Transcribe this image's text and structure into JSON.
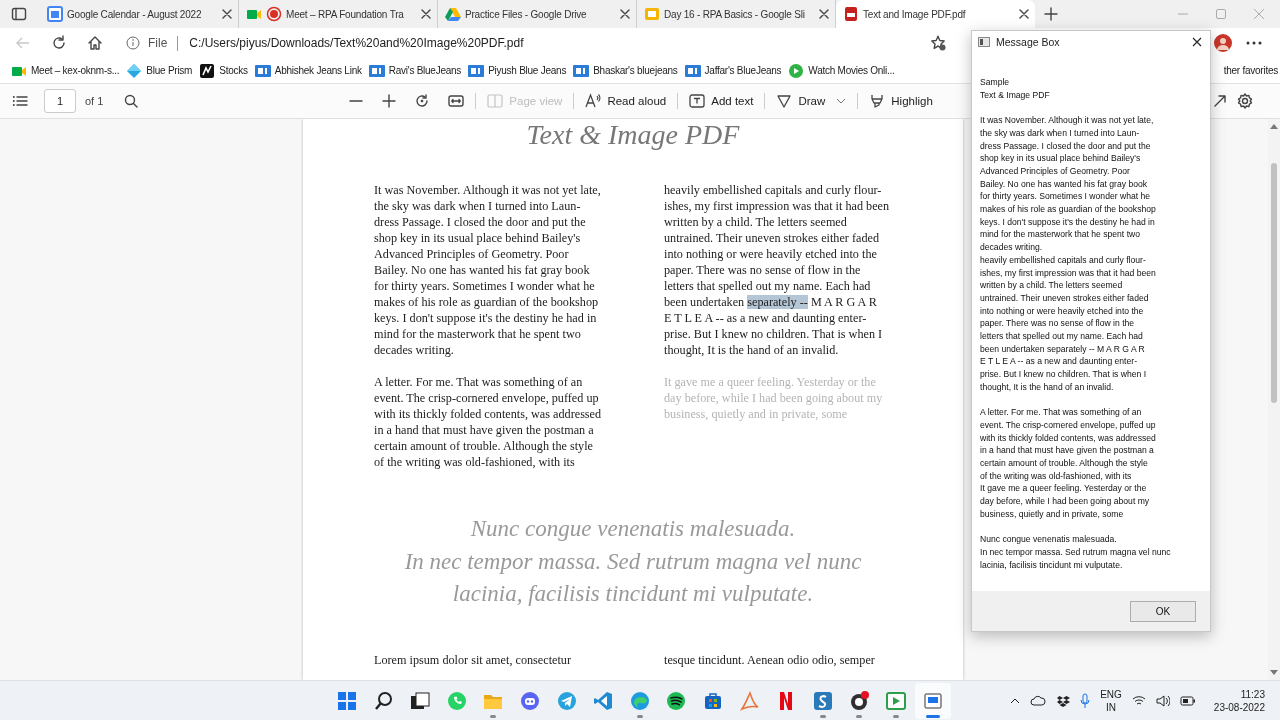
{
  "browser": {
    "tabs": [
      {
        "kind": "calendar",
        "title": "Google Calendar - August 2022",
        "selected": false
      },
      {
        "kind": "meet",
        "title": "Meet – RPA Foundation Tra",
        "selected": false
      },
      {
        "kind": "drive",
        "title": "Practice Files - Google Drive",
        "selected": false
      },
      {
        "kind": "slides",
        "title": "Day 16 - RPA Basics - Google Sli",
        "selected": false
      },
      {
        "kind": "pdf",
        "title": "Text and Image PDF.pdf",
        "selected": true
      }
    ],
    "back_disabled": true,
    "address_bar": {
      "scheme_label": "File",
      "url": "C:/Users/piyus/Downloads/Text%20and%20Image%20PDF.pdf"
    },
    "favorites": [
      {
        "kind": "meet",
        "label": "Meet – kex-oknm-s..."
      },
      {
        "kind": "prism",
        "label": "Blue Prism"
      },
      {
        "kind": "stocks",
        "label": "Stocks"
      },
      {
        "kind": "bluejeans",
        "label": "Abhishek Jeans Link"
      },
      {
        "kind": "bluejeans",
        "label": "Ravi's BlueJeans"
      },
      {
        "kind": "bluejeans",
        "label": "Piyush Blue Jeans"
      },
      {
        "kind": "bluejeans",
        "label": "Bhaskar's bluejeans"
      },
      {
        "kind": "bluejeans",
        "label": "Jaffar's BlueJeans"
      },
      {
        "kind": "play",
        "label": "Watch Movies Onli..."
      }
    ],
    "other_favorites": "ther favorites"
  },
  "pdf_toolbar": {
    "page": "1",
    "page_count": "of 1",
    "tools": [
      {
        "kind": "page_view",
        "label": "Page view",
        "disabled": true
      },
      {
        "kind": "read_aloud",
        "label": "Read aloud",
        "disabled": false
      },
      {
        "kind": "add_text",
        "label": "Add text",
        "disabled": false
      },
      {
        "kind": "draw",
        "label": "Draw",
        "disabled": false
      },
      {
        "kind": "highlight",
        "label": "Highligh",
        "disabled": false
      }
    ]
  },
  "document": {
    "title": "Text & Image PDF",
    "columns": [
      [
        {
          "faded": false,
          "segments": [
            {
              "text": "It was November. Although it was not yet late,\nthe sky was dark when I turned into Laun-\ndress Passage. I closed the door and put the\nshop key in its usual place behind Bailey's\nAdvanced Principles of Geometry. Poor\nBailey. No one has wanted his fat gray book\nfor thirty years. Sometimes I wonder what he\nmakes of his role as guardian of the bookshop\nkeys. I don't suppose it's the destiny he had in\nmind for the masterwork that he spent two\ndecades writing.",
              "selected": false
            }
          ]
        },
        {
          "faded": false,
          "segments": [
            {
              "text": "A letter. For me. That was something of an\nevent. The crisp-cornered envelope, puffed up\nwith its thickly folded contents, was addressed\nin a hand that must have given the postman a\ncertain amount of trouble. Although the style\nof the writing was old-fashioned, with its",
              "selected": false
            }
          ]
        }
      ],
      [
        {
          "faded": false,
          "segments": [
            {
              "text": "heavily embellished capitals and curly flour-\nishes, my first impression was that it had been\nwritten by a child. The letters seemed\nuntrained. Their uneven strokes either faded\ninto nothing or were heavily etched into the\npaper. There was no sense of flow in the\nletters that spelled out my name. Each had\nbeen undertaken ",
              "selected": false
            },
            {
              "text": "separately --",
              "selected": true
            },
            {
              "text": " M A R G A R\nE T L E A -- as a new and daunting enter-\nprise. But I knew no children. That is when I\nthought, It is the hand of an invalid.",
              "selected": false
            }
          ]
        },
        {
          "faded": true,
          "segments": [
            {
              "text": "It gave me a queer feeling. Yesterday or the\nday before, while I had been going about my\nbusiness, quietly and in private, some",
              "selected": false
            }
          ]
        }
      ]
    ],
    "quote": [
      "Nunc congue venenatis malesuada.",
      "In nec tempor massa. Sed rutrum magna vel nunc",
      "lacinia, facilisis tincidunt mi vulputate."
    ],
    "next_columns": [
      "Lorem ipsum dolor sit amet, consectetur",
      "tesque tincidunt. Aenean odio odio, semper"
    ]
  },
  "message_box": {
    "title": "Message Box",
    "paragraphs": [
      "Sample\nText & Image PDF",
      "It was November. Although it was not yet late,\nthe sky was dark when I turned into Laun-\ndress Passage. I closed the door and put the\nshop key in its usual place behind Bailey's\nAdvanced Principles of Geometry. Poor\nBailey. No one has wanted his fat gray book\nfor thirty years. Sometimes I wonder what he\nmakes of his role as guardian of the bookshop\nkeys. I don't suppose it's the destiny he had in\nmind for the masterwork that he spent two\ndecades writing.\nheavily embellished capitals and curly flour-\nishes, my first impression was that it had been\nwritten by a child. The letters seemed\nuntrained. Their uneven strokes either faded\ninto nothing or were heavily etched into the\npaper. There was no sense of flow in the\nletters that spelled out my name. Each had\nbeen undertaken separately -- M A R G A R\nE T L E A -- as a new and daunting enter-\nprise. But I knew no children. That is when I\nthought, It is the hand of an invalid.",
      "A letter. For me. That was something of an\nevent. The crisp-cornered envelope, puffed up\nwith its thickly folded contents, was addressed\nin a hand that must have given the postman a\ncertain amount of trouble. Although the style\nof the writing was old-fashioned, with its\nIt gave me a queer feeling. Yesterday or the\nday before, while I had been going about my\nbusiness, quietly and in private, some",
      "Nunc congue venenatis malesuada.\nIn nec tempor massa. Sed rutrum magna vel nunc\nlacinia, facilisis tincidunt mi vulputate."
    ],
    "button": "OK"
  },
  "taskbar": {
    "apps": [
      {
        "kind": "start",
        "running": false,
        "selected": false
      },
      {
        "kind": "search",
        "running": false,
        "selected": false
      },
      {
        "kind": "taskview",
        "running": false,
        "selected": false
      },
      {
        "kind": "chat",
        "running": false,
        "selected": false
      },
      {
        "kind": "folder",
        "running": true,
        "selected": false
      },
      {
        "kind": "gamechat",
        "running": false,
        "selected": false
      },
      {
        "kind": "plane",
        "running": false,
        "selected": false
      },
      {
        "kind": "code",
        "running": false,
        "selected": false
      },
      {
        "kind": "browser",
        "running": true,
        "selected": false
      },
      {
        "kind": "music",
        "running": false,
        "selected": false
      },
      {
        "kind": "store",
        "running": false,
        "selected": false
      },
      {
        "kind": "curve",
        "running": false,
        "selected": false
      },
      {
        "kind": "stream",
        "running": false,
        "selected": false
      },
      {
        "kind": "sapp",
        "running": true,
        "selected": false
      },
      {
        "kind": "record",
        "running": true,
        "selected": false
      },
      {
        "kind": "play",
        "running": true,
        "selected": false
      },
      {
        "kind": "window",
        "running": true,
        "selected": true
      }
    ],
    "language": "ENG",
    "region": "IN",
    "time": "11:23",
    "date": "23-08-2022"
  }
}
